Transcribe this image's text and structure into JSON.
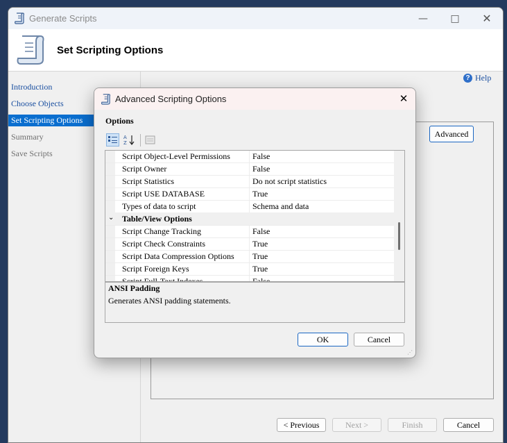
{
  "window": {
    "title": "Generate Scripts",
    "header_title": "Set Scripting Options",
    "help_label": "Help"
  },
  "nav": {
    "items": [
      {
        "label": "Introduction"
      },
      {
        "label": "Choose Objects"
      },
      {
        "label": "Set Scripting Options"
      },
      {
        "label": "Summary"
      },
      {
        "label": "Save Scripts"
      }
    ]
  },
  "main": {
    "advanced_label": "Advanced"
  },
  "footer": {
    "previous_label": "< Previous",
    "next_label": "Next >",
    "finish_label": "Finish",
    "cancel_label": "Cancel"
  },
  "dialog": {
    "title": "Advanced Scripting Options",
    "options_label": "Options",
    "rows": [
      {
        "name": "Script Object-Level Permissions",
        "value": "False"
      },
      {
        "name": "Script Owner",
        "value": "False"
      },
      {
        "name": "Script Statistics",
        "value": "Do not script statistics"
      },
      {
        "name": "Script USE DATABASE",
        "value": "True"
      },
      {
        "name": "Types of data to script",
        "value": "Schema and data"
      }
    ],
    "category": "Table/View Options",
    "rows2": [
      {
        "name": "Script Change Tracking",
        "value": "False"
      },
      {
        "name": "Script Check Constraints",
        "value": "True"
      },
      {
        "name": "Script Data Compression Options",
        "value": "True"
      },
      {
        "name": "Script Foreign Keys",
        "value": "True"
      },
      {
        "name": "Script Full-Text Indexes",
        "value": "False"
      }
    ],
    "desc_title": "ANSI Padding",
    "desc_text": "Generates ANSI padding statements.",
    "ok_label": "OK",
    "cancel_label": "Cancel"
  },
  "colors": {
    "accent": "#0a6ecf",
    "link": "#1a4fa0"
  }
}
